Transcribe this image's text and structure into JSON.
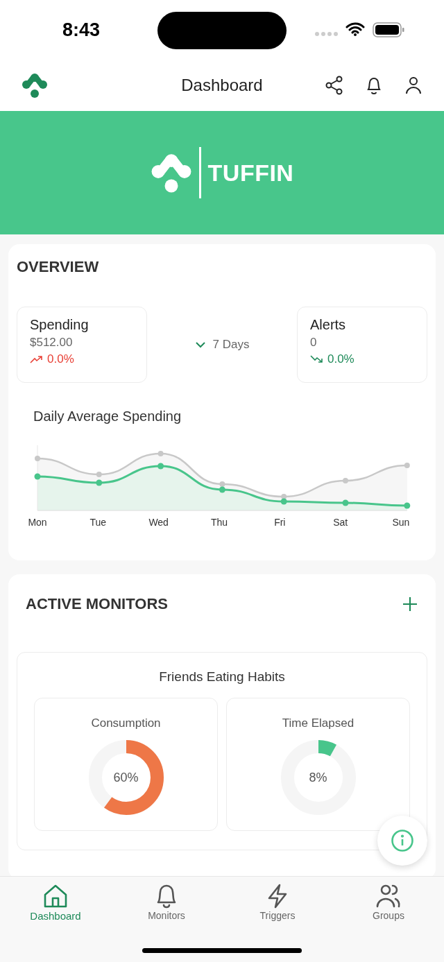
{
  "status_bar": {
    "time": "8:43"
  },
  "header": {
    "title": "Dashboard"
  },
  "banner": {
    "brand": "TUFFIN"
  },
  "overview": {
    "title": "OVERVIEW",
    "stats": [
      {
        "label": "Spending",
        "value": "$512.00",
        "change": "0.0%",
        "kind": "rise"
      },
      {
        "label": "Alerts",
        "value": "0",
        "change": "0.0%",
        "kind": "fall"
      }
    ],
    "period": "7 Days",
    "chart_title": "Daily Average Spending",
    "days": [
      "Mon",
      "Tue",
      "Wed",
      "Thu",
      "Fri",
      "Sat",
      "Sun"
    ]
  },
  "active_monitors": {
    "title": "ACTIVE MONITORS",
    "monitor": {
      "title": "Friends Eating Habits",
      "gauges": [
        {
          "label": "Consumption",
          "reading": "60%",
          "level": 0.6,
          "color": "#ee7747"
        },
        {
          "label": "Time Elapsed",
          "reading": "8%",
          "level": 0.08,
          "color": "#48c58b"
        }
      ]
    }
  },
  "tab_bar": [
    {
      "label": "Dashboard",
      "selected": true
    },
    {
      "label": "Monitors",
      "selected": false
    },
    {
      "label": "Triggers",
      "selected": false
    },
    {
      "label": "Groups",
      "selected": false
    }
  ]
}
